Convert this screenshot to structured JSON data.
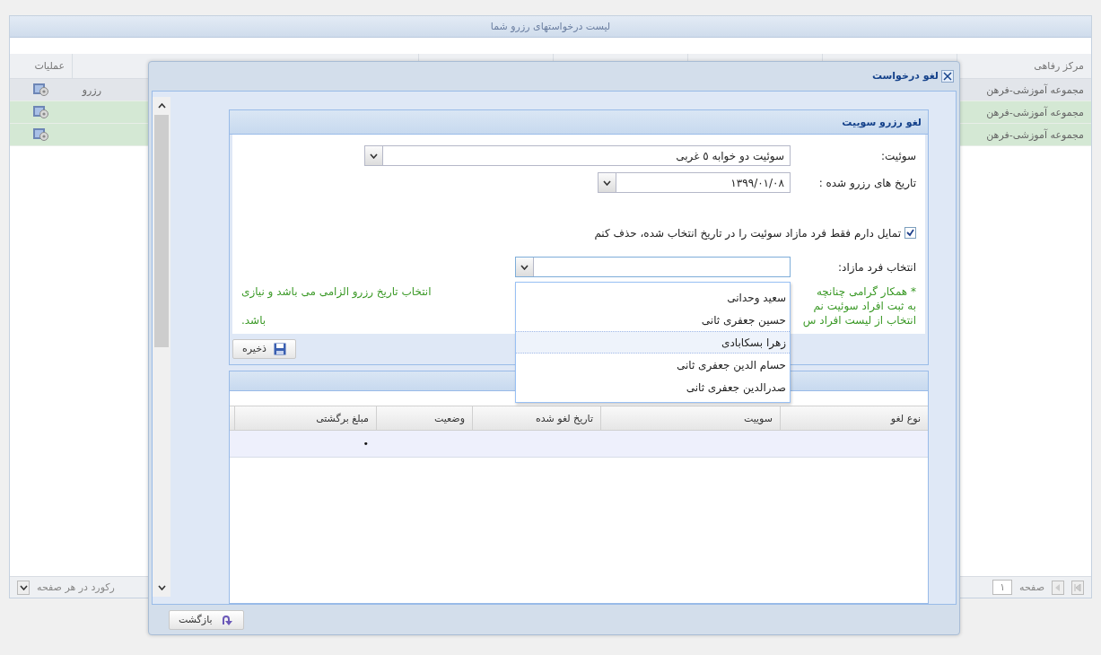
{
  "page": {
    "title": "لیست درخواستهای رزرو شما",
    "columns": [
      {
        "label": "مرکز رفاهی"
      },
      {
        "label": "عملیات"
      }
    ],
    "rows": [
      {
        "center": "مجموعه آموزشی-فرهن",
        "column_2": "رزرو",
        "selected": true
      },
      {
        "center": "مجموعه آموزشی-فرهن",
        "selected": false
      },
      {
        "center": "مجموعه آموزشی-فرهن",
        "selected": false
      }
    ],
    "pager": {
      "page_label": "صفحه",
      "page_value": "١",
      "per_page_label": "رکورد در هر صفحه"
    }
  },
  "dialog": {
    "title": "لغو درخواست",
    "panel_title": "لغو رزرو سوییت",
    "suite": {
      "label": "سوئیت:",
      "value": "سوئیت دو خوابه ٥ غربی"
    },
    "dates": {
      "label": "تاریخ های رزرو شده :",
      "value": "١٣٩٩/٠١/٠٨"
    },
    "only_extra": {
      "label": "تمایل دارم فقط فرد مازاد سوئیت را در تاریخ انتخاب شده، حذف کنم",
      "checked": true
    },
    "extra_person": {
      "label": "انتخاب فرد مازاد:",
      "expanded": true,
      "options": [
        {
          "label": "سعید وحدانی",
          "selected": false
        },
        {
          "label": "حسین جعفری ثانی",
          "selected": false
        },
        {
          "label": "زهرا بسکابادی",
          "selected": true
        },
        {
          "label": "حسام الدین جعفری ثانی",
          "selected": false
        },
        {
          "label": "صدرالدین جعفری ثانی",
          "selected": false
        }
      ]
    },
    "note": [
      {
        "right": "* همکار گرامی چنانچه",
        "left": "انتخاب تاریخ رزرو الزامی می باشد و نیازی"
      },
      {
        "right": "به ثبت افراد سوئیت نم"
      },
      {
        "right": "انتخاب از لیست افراد س",
        "left": "باشد."
      }
    ],
    "save": "ذخیره",
    "table": {
      "columns": [
        "نوع لغو",
        "سوییت",
        "تاریخ لغو شده",
        "وضعیت",
        "مبلغ برگشتی"
      ],
      "rows": [
        {
          "refund": "•"
        }
      ]
    },
    "back": "بازگشت"
  }
}
